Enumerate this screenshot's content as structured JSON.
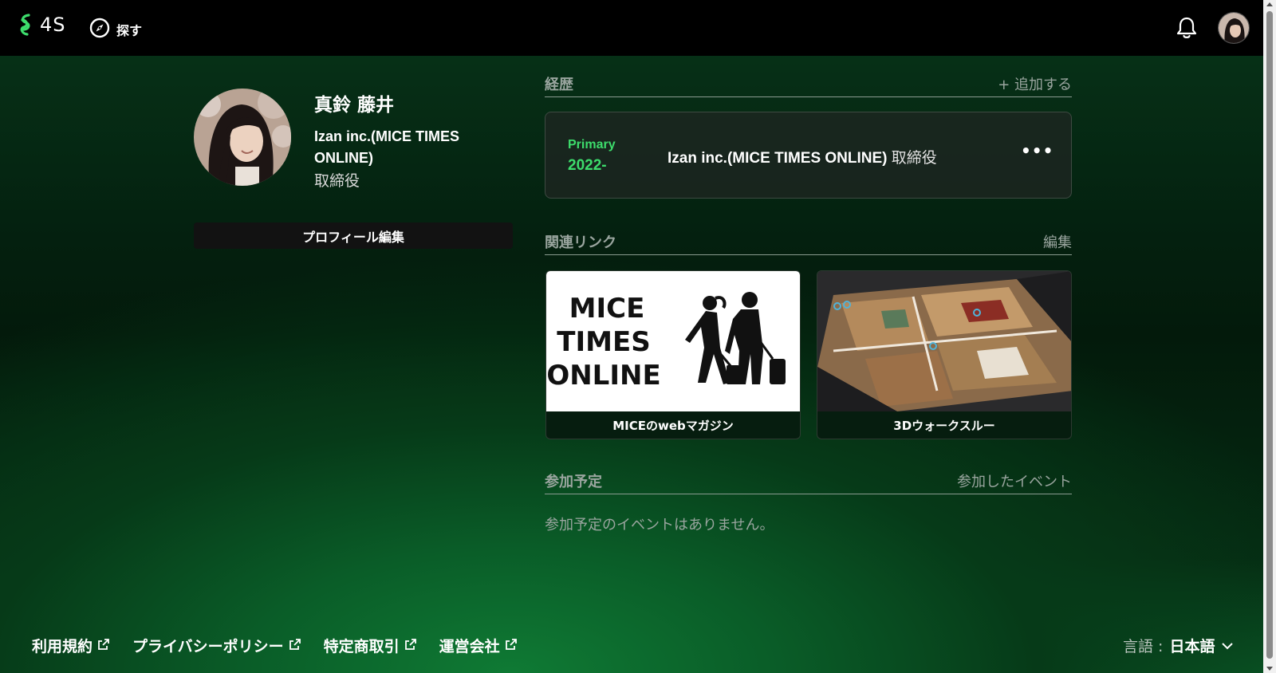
{
  "header": {
    "brand": "4S",
    "explore_label": "探す"
  },
  "profile": {
    "name": "真鈴 藤井",
    "company": "Izan inc.(MICE TIMES ONLINE)",
    "title": "取締役",
    "edit_button": "プロフィール編集"
  },
  "career": {
    "title": "経歴",
    "add_action": "+ 追加する",
    "entries": [
      {
        "badge": "Primary",
        "period": "2022-",
        "company": "Izan inc.(MICE TIMES ONLINE)",
        "role": "取締役"
      }
    ]
  },
  "links": {
    "title": "関連リンク",
    "edit_action": "編集",
    "items": [
      {
        "label": "MICEのwebマガジン",
        "logo_lines": [
          "MICE",
          "TIMES",
          "ONLINE"
        ]
      },
      {
        "label": "3Dウォークスルー"
      }
    ]
  },
  "events": {
    "title": "参加予定",
    "past_action": "参加したイベント",
    "empty_message": "参加予定のイベントはありません。"
  },
  "footer": {
    "links": [
      "利用規約",
      "プライバシーポリシー",
      "特定商取引",
      "運営会社"
    ],
    "language_label": "言語 :",
    "language_value": "日本語"
  },
  "colors": {
    "accent_green": "#3ddc6c",
    "header_bg": "#000000",
    "muted_text": "#9aa59f"
  }
}
